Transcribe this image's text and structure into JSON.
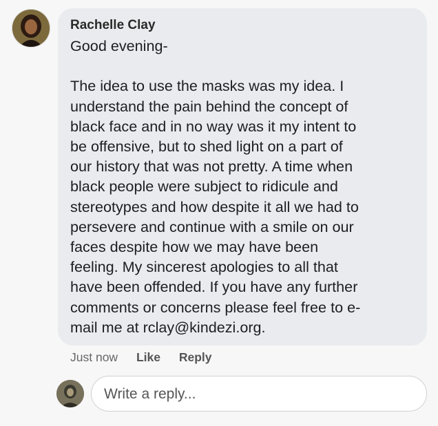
{
  "comment": {
    "author": "Rachelle Clay",
    "greeting": "Good evening-",
    "lines": [
      "The idea to use the masks was my idea. I",
      "understand the pain behind the concept of",
      "black face and in no way was it my intent to",
      "be offensive, but to shed light on a part of",
      "our history that was not pretty. A time when",
      "black people were subject to ridicule and",
      "stereotypes and how despite it all we had to",
      "persevere and continue with a smile on our",
      "faces despite how we may have been",
      "feeling. My sincerest apologies to all that",
      "have been offended. If you have any further",
      "comments or concerns please feel free to e-",
      "mail me at rclay@kindezi.org."
    ],
    "timestamp": "Just now",
    "like_label": "Like",
    "reply_label": "Reply"
  },
  "reply_box": {
    "placeholder": "Write a reply..."
  },
  "colors": {
    "bubble": "#e9ebee",
    "text": "#1c1e21",
    "meta": "#666666"
  },
  "icons": {
    "author_avatar": "profile-photo",
    "reply_avatar": "profile-photo"
  }
}
